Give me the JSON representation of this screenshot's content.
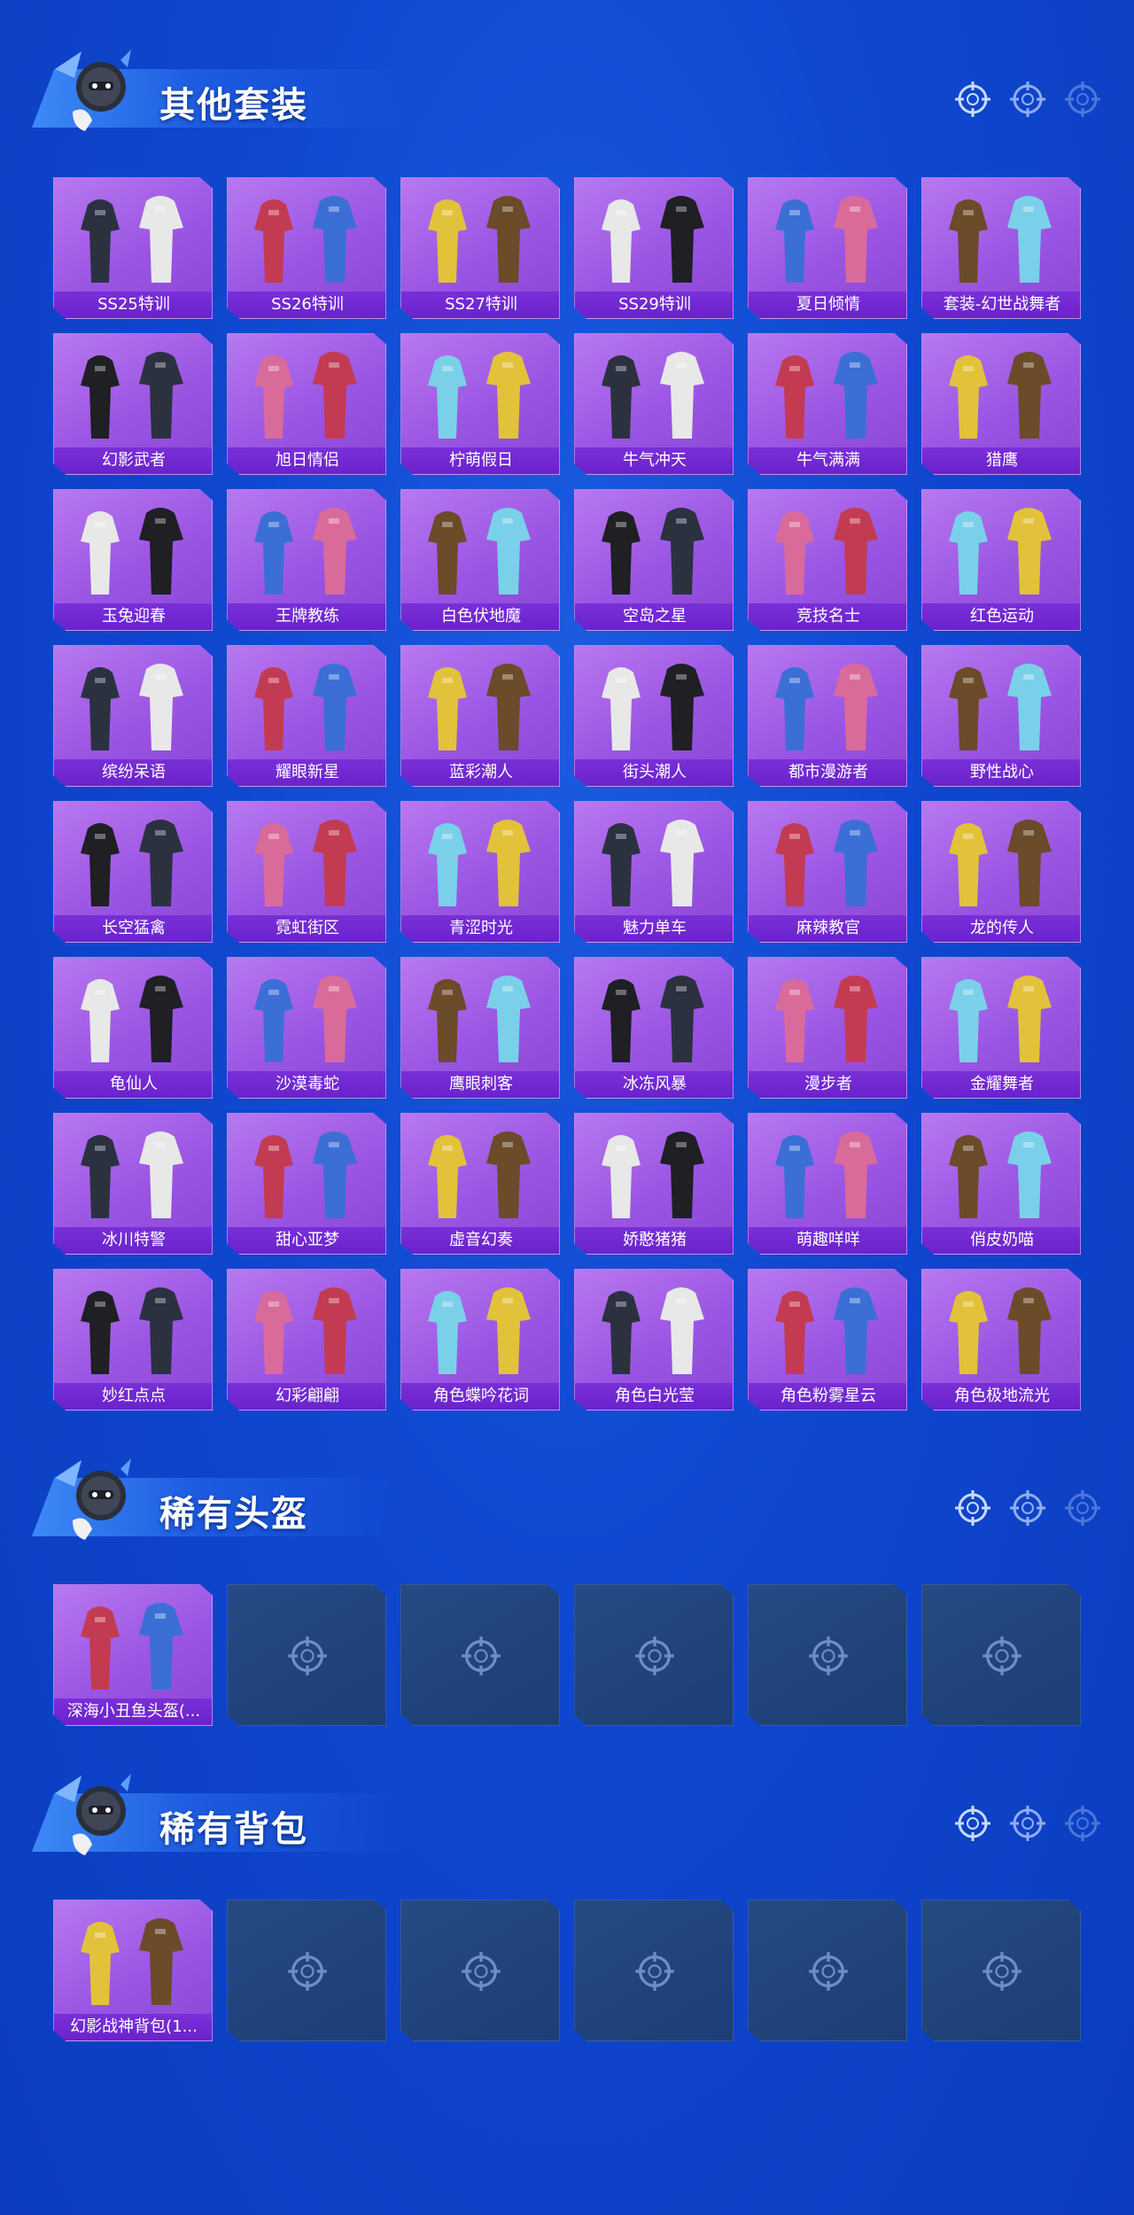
{
  "sections": [
    {
      "title": "其他套装",
      "items": [
        "SS25特训",
        "SS26特训",
        "SS27特训",
        "SS29特训",
        "夏日倾情",
        "套装-幻世战舞者",
        "幻影武者",
        "旭日情侣",
        "柠萌假日",
        "牛气冲天",
        "牛气满满",
        "猎鹰",
        "玉兔迎春",
        "王牌教练",
        "白色伏地魔",
        "空岛之星",
        "竞技名士",
        "红色运动",
        "缤纷呆语",
        "耀眼新星",
        "蓝彩潮人",
        "街头潮人",
        "都市漫游者",
        "野性战心",
        "长空猛禽",
        "霓虹街区",
        "青涩时光",
        "魅力单车",
        "麻辣教官",
        "龙的传人",
        "龟仙人",
        "沙漠毒蛇",
        "鹰眼刺客",
        "冰冻风暴",
        "漫步者",
        "金耀舞者",
        "冰川特警",
        "甜心亚梦",
        "虚音幻奏",
        "娇憨猪猪",
        "萌趣咩咩",
        "俏皮奶喵",
        "妙红点点",
        "幻彩翩翩",
        "角色蝶吟花词",
        "角色白光莹",
        "角色粉雾星云",
        "角色极地流光"
      ]
    },
    {
      "title": "稀有头盔",
      "items": [
        "深海小丑鱼头盔(..."
      ],
      "empty_slots": 5
    },
    {
      "title": "稀有背包",
      "items": [
        "幻影战神背包(1..."
      ],
      "empty_slots": 5
    }
  ],
  "icons": {
    "mascot": "mascot-icon",
    "deco": "crosshair-icon",
    "empty": "crosshair-icon"
  },
  "colors": {
    "background": "#0f47cf",
    "card": "#9a55e3",
    "label_bar": "#6a22cc",
    "empty_card": "#1d3e76"
  }
}
